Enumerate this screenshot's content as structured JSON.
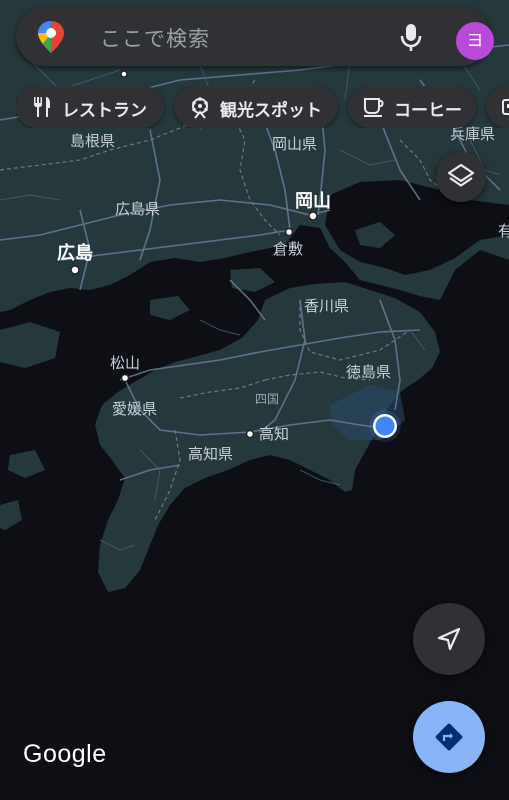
{
  "search": {
    "placeholder": "ここで検索",
    "avatar_initial": "ヨ"
  },
  "chips": [
    {
      "label": "レストラン",
      "icon": "restaurant-icon"
    },
    {
      "label": "観光スポット",
      "icon": "attractions-icon"
    },
    {
      "label": "コーヒー",
      "icon": "coffee-icon"
    }
  ],
  "map": {
    "labels": {
      "shimane": "島根県",
      "okayama_pref": "岡山県",
      "hyogo": "兵庫県",
      "hiroshima_pref": "広島県",
      "okayama_city": "岡山",
      "kurashiki": "倉敷",
      "hiroshima_city": "広島",
      "kagawa": "香川県",
      "matsuyama": "松山",
      "tokushima": "徳島県",
      "shikoku": "四国",
      "ehime": "愛媛県",
      "kochi_city": "高知",
      "kochi_pref": "高知県",
      "partial_right": "有"
    }
  },
  "attribution": "Google",
  "colors": {
    "land": "#25393d",
    "sea": "#0d0f14",
    "road": "#6a7a9a",
    "border": "#8a96a0",
    "chip_bg": "#303134",
    "location_dot": "#4285f4",
    "directions_fab": "#8ab4f8",
    "avatar": "#b74ad6"
  }
}
